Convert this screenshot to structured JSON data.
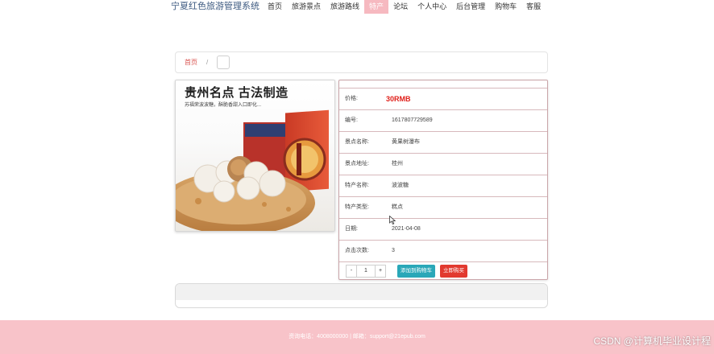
{
  "header": {
    "brand": "宁夏红色旅游管理系统",
    "nav": [
      {
        "label": "首页",
        "active": false
      },
      {
        "label": "旅游景点",
        "active": false
      },
      {
        "label": "旅游路线",
        "active": false
      },
      {
        "label": "特产",
        "active": true
      },
      {
        "label": "论坛",
        "active": false
      },
      {
        "label": "个人中心",
        "active": false
      },
      {
        "label": "后台管理",
        "active": false
      },
      {
        "label": "购物车",
        "active": false
      },
      {
        "label": "客服",
        "active": false
      }
    ]
  },
  "breadcrumb": {
    "home": "首页",
    "separator": "/"
  },
  "product_image": {
    "headline": "贵州名点 古法制造",
    "subline": "苏福荣波波糖，酥脆香甜入口即化..."
  },
  "info": {
    "rows": [
      {
        "label": "价格:",
        "value": "30RMB"
      },
      {
        "label": "编号:",
        "value": "1617807729589"
      },
      {
        "label": "景点名称:",
        "value": "黄果树瀑布"
      },
      {
        "label": "景点地址:",
        "value": "桂州"
      },
      {
        "label": "特产名称:",
        "value": "波波糖"
      },
      {
        "label": "特产类型:",
        "value": "糕点"
      },
      {
        "label": "日期:",
        "value": "2021-04-08"
      },
      {
        "label": "点击次数:",
        "value": "3"
      }
    ],
    "quantity": {
      "minus": "-",
      "value": "1",
      "plus": "+"
    },
    "add_to_cart": "添加到购物车",
    "buy_now": "立即购买"
  },
  "footer": {
    "text": "资询电话：4008000000 | 邮箱：support@21epub.com"
  },
  "watermark": "CSDN @计算机毕业设计程",
  "colors": {
    "accent": "#f6b9c0",
    "price": "#e0201a",
    "cart_button": "#2aa7b8",
    "buy_button": "#e2392f",
    "footer": "#f8c3c9"
  }
}
